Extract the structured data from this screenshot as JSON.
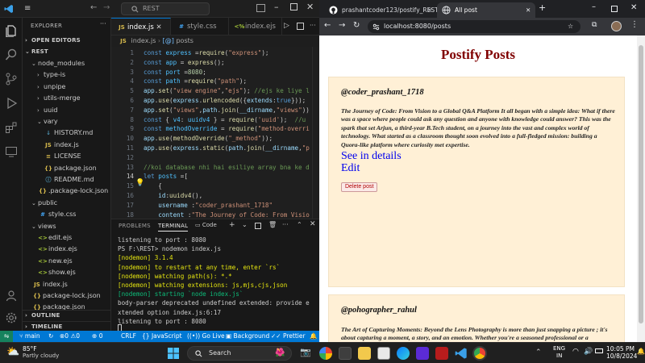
{
  "vscode": {
    "command_center": "REST",
    "explorer": {
      "title": "EXPLORER",
      "open_editors": "OPEN EDITORS",
      "root": "REST",
      "tree": [
        {
          "label": "node_modules",
          "kind": "folder",
          "depth": 1,
          "color": "#cccccc"
        },
        {
          "label": "type-is",
          "kind": "folder-closed",
          "depth": 2,
          "color": "#cccccc"
        },
        {
          "label": "unpipe",
          "kind": "folder-closed",
          "depth": 2,
          "color": "#cccccc"
        },
        {
          "label": "utils-merge",
          "kind": "folder-closed",
          "depth": 2,
          "color": "#cccccc"
        },
        {
          "label": "uuid",
          "kind": "folder-closed",
          "depth": 2,
          "color": "#cccccc"
        },
        {
          "label": "vary",
          "kind": "folder",
          "depth": 2,
          "color": "#cccccc"
        },
        {
          "label": "HISTORY.md",
          "kind": "md",
          "depth": 3,
          "color": "#cccccc"
        },
        {
          "label": "index.js",
          "kind": "js",
          "depth": 3,
          "color": "#cccccc"
        },
        {
          "label": "LICENSE",
          "kind": "license",
          "depth": 3,
          "color": "#cccccc"
        },
        {
          "label": "package.json",
          "kind": "json",
          "depth": 3,
          "color": "#cccccc"
        },
        {
          "label": "README.md",
          "kind": "info",
          "depth": 3,
          "color": "#cccccc"
        },
        {
          "label": ".package-lock.json",
          "kind": "json",
          "depth": 2,
          "color": "#cccccc"
        },
        {
          "label": "public",
          "kind": "folder",
          "depth": 1,
          "color": "#cccccc"
        },
        {
          "label": "style.css",
          "kind": "css",
          "depth": 2,
          "color": "#cccccc"
        },
        {
          "label": "views",
          "kind": "folder",
          "depth": 1,
          "color": "#cccccc"
        },
        {
          "label": "edit.ejs",
          "kind": "ejs",
          "depth": 2,
          "color": "#cccccc"
        },
        {
          "label": "index.ejs",
          "kind": "ejs",
          "depth": 2,
          "color": "#cccccc"
        },
        {
          "label": "new.ejs",
          "kind": "ejs",
          "depth": 2,
          "color": "#cccccc"
        },
        {
          "label": "show.ejs",
          "kind": "ejs",
          "depth": 2,
          "color": "#cccccc"
        },
        {
          "label": "index.js",
          "kind": "js",
          "depth": 1,
          "color": "#cccccc"
        },
        {
          "label": "package-lock.json",
          "kind": "json",
          "depth": 1,
          "color": "#cccccc"
        },
        {
          "label": "package.json",
          "kind": "json",
          "depth": 1,
          "color": "#cccccc"
        }
      ],
      "outline": "OUTLINE",
      "timeline": "TIMELINE"
    },
    "tabs": [
      {
        "label": "index.js",
        "icon": "JS",
        "active": true
      },
      {
        "label": "style.css",
        "icon": "#",
        "active": false
      },
      {
        "label": "index.ejs",
        "icon": "<%",
        "active": false
      }
    ],
    "breadcrumb": {
      "file": "index.js",
      "symbol": "posts"
    },
    "editor": {
      "current_line": 14,
      "lines": [
        {
          "n": "1",
          "html": "<span class='k'>const</span> <span class='v'>express</span> <span class='o'>=</span><span class='f'>require</span>(<span class='s'>\"express\"</span>);"
        },
        {
          "n": "2",
          "html": "<span class='k'>const</span> <span class='v'>app</span> <span class='o'>=</span> <span class='f'>express</span>();"
        },
        {
          "n": "3",
          "html": "<span class='k'>const</span> <span class='v'>port</span> <span class='o'>=</span><span class='n'>8080</span>;"
        },
        {
          "n": "4",
          "html": "<span class='k'>const</span> <span class='v'>path</span> <span class='o'>=</span><span class='f'>require</span>(<span class='s'>\"path\"</span>);"
        },
        {
          "n": "5",
          "html": "<span class='p'>app</span>.<span class='f'>set</span>(<span class='s'>\"view engine\"</span>,<span class='s'>\"ejs\"</span>); <span class='c'>//ejs ke liye l</span>"
        },
        {
          "n": "6",
          "html": "<span class='p'>app</span>.<span class='f'>use</span>(<span class='p'>express</span>.<span class='f'>urlencoded</span>({<span class='p'>extends</span>:<span class='k'>true</span>}));"
        },
        {
          "n": "7",
          "html": "<span class='p'>app</span>.<span class='f'>set</span>(<span class='s'>\"views\"</span>,<span class='p'>path</span>.<span class='f'>join</span>(<span class='p'>__dirname</span>,<span class='s'>\"views\"</span>))"
        },
        {
          "n": "8",
          "html": "<span class='k'>const</span> { <span class='v'>v4</span>: <span class='v'>uuidv4</span> } <span class='o'>=</span> <span class='f'>require</span>(<span class='s'>'uuid'</span>);  <span class='c'>//u</span>"
        },
        {
          "n": "9",
          "html": "<span class='k'>const</span> <span class='v'>methodOverride</span> <span class='o'>=</span> <span class='f'>require</span>(<span class='s'>\"method-overri</span>"
        },
        {
          "n": "10",
          "html": "<span class='p'>app</span>.<span class='f'>use</span>(<span class='f'>methodOverride</span>(<span class='s'>\"_method\"</span>));"
        },
        {
          "n": "11",
          "html": "<span class='p'>app</span>.<span class='f'>use</span>(<span class='p'>express</span>.<span class='f'>static</span>(<span class='p'>path</span>.<span class='f'>join</span>(<span class='p'>__dirname</span>,<span class='s'>\"p</span>"
        },
        {
          "n": "12",
          "html": ""
        },
        {
          "n": "13",
          "html": "<span class='c'>//koi database nhi hai esiliye array bna ke d</span>"
        },
        {
          "n": "14",
          "html": "<span class='k'>let</span> <span class='v'>posts</span> <span class='o'>=</span>["
        },
        {
          "n": "15",
          "html": "    {"
        },
        {
          "n": "16",
          "html": "    <span class='p'>id</span>:<span class='f'>uuidv4</span>(),"
        },
        {
          "n": "17",
          "html": "    <span class='p'>username</span> :<span class='s'>\"coder_prashant_1718\"</span>"
        },
        {
          "n": "18",
          "html": "    <span class='p'>content</span> :<span class='s'>\"The Journey of Code: From Visio</span>"
        }
      ]
    },
    "panel": {
      "tabs": [
        "PROBLEMS",
        "TERMINAL"
      ],
      "active_tab": "TERMINAL",
      "shell_label": "Code",
      "terminal": [
        {
          "cls": "",
          "text": "listening to port : 8080"
        },
        {
          "cls": "",
          "text": "PS F:\\REST> nodemon index.js"
        },
        {
          "cls": "tyel",
          "text": "[nodemon] 3.1.4"
        },
        {
          "cls": "tyel",
          "text": "[nodemon] to restart at any time, enter `rs`"
        },
        {
          "cls": "tyel",
          "text": "[nodemon] watching path(s): *.*"
        },
        {
          "cls": "tyel",
          "text": "[nodemon] watching extensions: js,mjs,cjs,json"
        },
        {
          "cls": "tgrn",
          "text": "[nodemon] starting `node index.js`"
        },
        {
          "cls": "",
          "text": "body-parser deprecated undefined extended: provide e"
        },
        {
          "cls": "",
          "text": "xtended option index.js:6:17"
        },
        {
          "cls": "",
          "text": "listening to port : 8080"
        }
      ]
    },
    "statusbar": {
      "branch": "main",
      "errors": "0",
      "warnings": "0",
      "ports": "0",
      "eol": "CRLF",
      "language": "JavaScript",
      "golive": "Go Live",
      "background": "Background",
      "prettier": "Prettier"
    }
  },
  "chrome": {
    "tabs": [
      {
        "label": "prashantcoder123/postify_REST",
        "active": false
      },
      {
        "label": "All post",
        "active": true
      }
    ],
    "url": "localhost:8080/posts",
    "page": {
      "title": "Postify Posts",
      "posts": [
        {
          "username": "@coder_prashant_1718",
          "content": "The Journey of Code: From Vision to a Global Q&A Platform It all began with a simple idea: What if there was a space where people could ask any question and anyone with knowledge could answer? This was the spark that set Arjun, a third-year B.Tech student, on a journey into the vast and complex world of technology. What started as a classroom thought soon evolved into a full-fledged mission: building a Quora-like platform where curiosity met expertise.",
          "details_link": "See in details",
          "edit_link": "Edit",
          "delete_label": "Delete post"
        },
        {
          "username": "@pohographer_rahul",
          "content": "The Art of Capturing Moments: Beyond the Lens Photography is more than just snapping a picture ; it's about capturing a moment, a story, and an emotion. Whether you're a seasoned professional or a"
        }
      ]
    }
  },
  "taskbar": {
    "weather_temp": "85°F",
    "weather_desc": "Partly cloudy",
    "search_label": "Search",
    "lang_1": "ENG",
    "lang_2": "IN",
    "time": "10:05 PM",
    "date": "10/8/2024"
  }
}
